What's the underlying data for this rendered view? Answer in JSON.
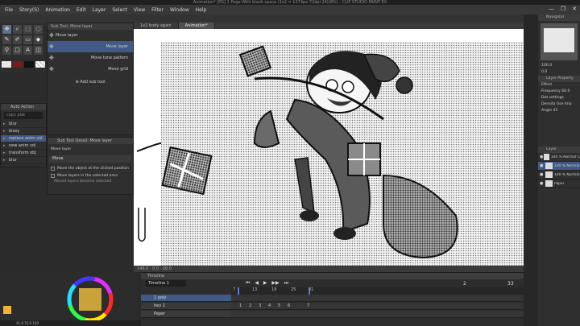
{
  "window": {
    "title": "Animation* [PG] 1 Page With blank space (1x2 = 1374px 72dpi 24)(8%) - CLIP STUDIO PAINT EX",
    "controls": [
      "—",
      "❐",
      "✕"
    ]
  },
  "menu": [
    "File",
    "Story(S)",
    "Animation",
    "Edit",
    "Layer",
    "Select",
    "View",
    "Filter",
    "Window",
    "Help"
  ],
  "subtool": {
    "tabs": [
      "Sub Tool: Move layer"
    ],
    "items": [
      {
        "label": "Move layer",
        "selected": false,
        "icon": "✥"
      },
      {
        "label": "Move layer",
        "selected": true,
        "icon": "✥"
      },
      {
        "label": "Move tone pattern",
        "selected": false,
        "icon": "✥"
      },
      {
        "label": "Move grid",
        "selected": false,
        "icon": "✥"
      }
    ],
    "add_label": "Add sub tool"
  },
  "left_list": {
    "header": "Auto Action",
    "search": "copy plat",
    "items": [
      {
        "label": "blur",
        "selected": false
      },
      {
        "label": "bloxy",
        "selected": false
      },
      {
        "label": "replace anim vol",
        "selected": true
      },
      {
        "label": "new anim vol",
        "selected": false
      },
      {
        "label": "transform obj",
        "selected": false
      },
      {
        "label": "blur",
        "selected": false
      }
    ]
  },
  "tool_property": {
    "header": "Sub Tool Detail: Move layer",
    "title": "Move layer",
    "section": "Move",
    "options": [
      "Move the object at the clicked position",
      "Move layers in the selected area"
    ],
    "note": "Moved layers become selected"
  },
  "documents": {
    "tabs": [
      {
        "label": "1x2 body again",
        "active": false
      },
      {
        "label": "Animation*",
        "active": true
      }
    ]
  },
  "canvas_status": "146.0  ·  0.0  ·  20.0",
  "timeline": {
    "header": "Timeline",
    "selector": "Timeline 1",
    "controls": [
      "⏮",
      "◀",
      "▶",
      "▶▶",
      "⏭"
    ],
    "ruler_labels": [
      "7",
      "13",
      "19",
      "25",
      "31"
    ],
    "frame_counter": "2",
    "frame_total": "33",
    "tracks": [
      {
        "label": "1 poly",
        "selected": true,
        "frames": []
      },
      {
        "label": "hev 1",
        "selected": false,
        "frames": [
          "1",
          "2",
          "3",
          "4",
          "5",
          "6",
          "7"
        ]
      },
      {
        "label": "Paper",
        "selected": false,
        "frames": []
      }
    ]
  },
  "statusbar": "41.8   76.9   100",
  "navigator": {
    "header": "Navigator",
    "zoom": "100.0",
    "rotate": "0.0"
  },
  "layer_property": {
    "header": "Layer Property",
    "effect": "Effect",
    "frequency_label": "Frequency",
    "frequency_value": "60.0",
    "dot_settings": "Dot settings",
    "density_label": "Density",
    "density_value": "Use Ima",
    "angle_label": "Angle",
    "angle_value": "45"
  },
  "layers": {
    "header": "Layer",
    "items": [
      {
        "label": "100 % Normal Canvas",
        "selected": false
      },
      {
        "label": "100 % Normal",
        "selected": true
      },
      {
        "label": "100 % Normal",
        "selected": false
      },
      {
        "label": "Paper",
        "selected": false
      }
    ]
  }
}
